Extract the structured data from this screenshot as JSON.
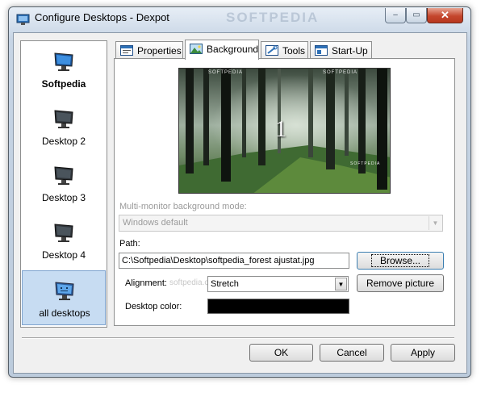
{
  "window": {
    "title": "Configure Desktops - Dexpot",
    "title_watermark": "SOFTPEDIA",
    "close_glyph": "✕",
    "minimize_glyph": "–",
    "maximize_glyph": "▭"
  },
  "desktops": [
    {
      "label": "Softpedia",
      "selected": false,
      "bold": true,
      "icon": "monitor-icon"
    },
    {
      "label": "Desktop 2",
      "selected": false,
      "icon": "monitor-icon"
    },
    {
      "label": "Desktop 3",
      "selected": false,
      "icon": "monitor-icon"
    },
    {
      "label": "Desktop 4",
      "selected": false,
      "icon": "monitor-icon"
    },
    {
      "label": "all desktops",
      "selected": true,
      "icon": "multi-monitor-icon"
    }
  ],
  "tabs": [
    {
      "label": "Properties",
      "icon": "properties-icon",
      "active": false
    },
    {
      "label": "Background",
      "icon": "picture-icon",
      "active": true
    },
    {
      "label": "Tools",
      "icon": "tools-icon",
      "active": false
    },
    {
      "label": "Start-Up",
      "icon": "startup-icon",
      "active": false
    }
  ],
  "preview": {
    "desktop_number": "1",
    "overlay_texts": [
      "SOFTPEDIA",
      "SOFTPEDIA",
      "SOFTPEDIA"
    ]
  },
  "background": {
    "multi_monitor_label": "Multi-monitor background mode:",
    "multi_monitor_value": "Windows default",
    "path_label": "Path:",
    "path_value": "C:\\Softpedia\\Desktop\\softpedia_forest ajustat.jpg",
    "browse_label": "Browse...",
    "alignment_label": "Alignment:",
    "alignment_value": "Stretch",
    "remove_label": "Remove picture",
    "desktop_color_label": "Desktop color:",
    "desktop_color_value": "#000000",
    "watermark": "softpedia.com"
  },
  "footer": {
    "ok_label": "OK",
    "cancel_label": "Cancel",
    "apply_label": "Apply"
  },
  "colors": {
    "selection_bg": "#c7dcf2",
    "close_red": "#c4462d",
    "focus_blue": "#3c7fb1"
  }
}
